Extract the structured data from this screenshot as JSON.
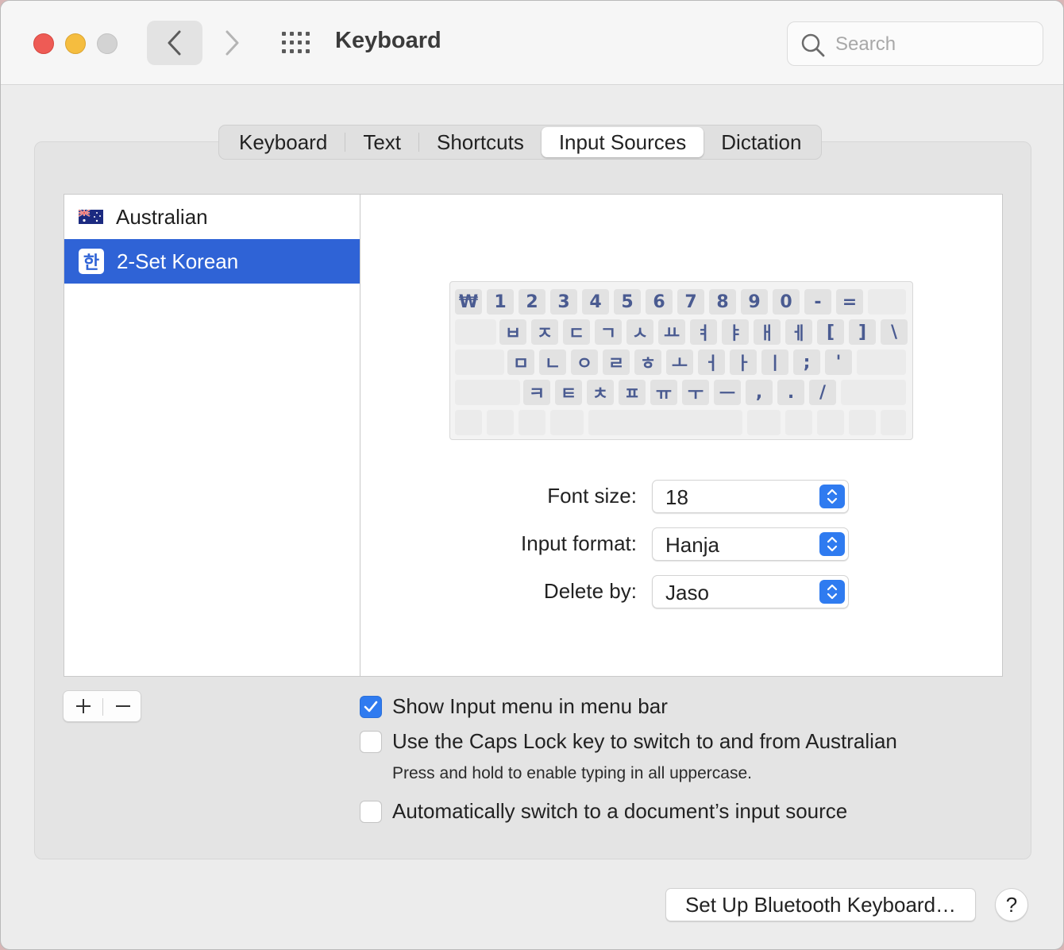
{
  "window": {
    "title": "Keyboard",
    "search_placeholder": "Search"
  },
  "tabs": [
    {
      "label": "Keyboard"
    },
    {
      "label": "Text"
    },
    {
      "label": "Shortcuts"
    },
    {
      "label": "Input Sources",
      "active": true
    },
    {
      "label": "Dictation"
    }
  ],
  "sources": [
    {
      "label": "Australian",
      "icon": "australia-flag-icon"
    },
    {
      "label": "2-Set Korean",
      "icon": "hangul-icon",
      "icon_glyph": "한",
      "selected": true
    }
  ],
  "keyboard": {
    "row1": [
      "₩",
      "1",
      "2",
      "3",
      "4",
      "5",
      "6",
      "7",
      "8",
      "9",
      "0",
      "-",
      "="
    ],
    "row2": [
      "ㅂ",
      "ㅈ",
      "ㄷ",
      "ㄱ",
      "ㅅ",
      "ㅛ",
      "ㅕ",
      "ㅑ",
      "ㅐ",
      "ㅔ",
      "[",
      "]",
      "\\"
    ],
    "row3": [
      "ㅁ",
      "ㄴ",
      "ㅇ",
      "ㄹ",
      "ㅎ",
      "ㅗ",
      "ㅓ",
      "ㅏ",
      "ㅣ",
      ";",
      "'"
    ],
    "row4": [
      "ㅋ",
      "ㅌ",
      "ㅊ",
      "ㅍ",
      "ㅠ",
      "ㅜ",
      "ㅡ",
      ",",
      ".",
      "/"
    ]
  },
  "settings": {
    "font_size": {
      "label": "Font size:",
      "value": "18"
    },
    "input_format": {
      "label": "Input format:",
      "value": "Hanja"
    },
    "delete_by": {
      "label": "Delete by:",
      "value": "Jaso"
    }
  },
  "options": {
    "show_input_menu": {
      "label": "Show Input menu in menu bar",
      "checked": true
    },
    "caps_lock_switch": {
      "label": "Use the Caps Lock key to switch to and from Australian",
      "checked": false
    },
    "caps_lock_hint": "Press and hold to enable typing in all uppercase.",
    "auto_switch": {
      "label": "Automatically switch to a document’s input source",
      "checked": false
    }
  },
  "footer": {
    "bluetooth_button": "Set Up Bluetooth Keyboard…",
    "help_label": "?"
  },
  "colors": {
    "accent": "#2f7bf0",
    "selection": "#2f63d6",
    "key_text": "#4a5b91"
  }
}
